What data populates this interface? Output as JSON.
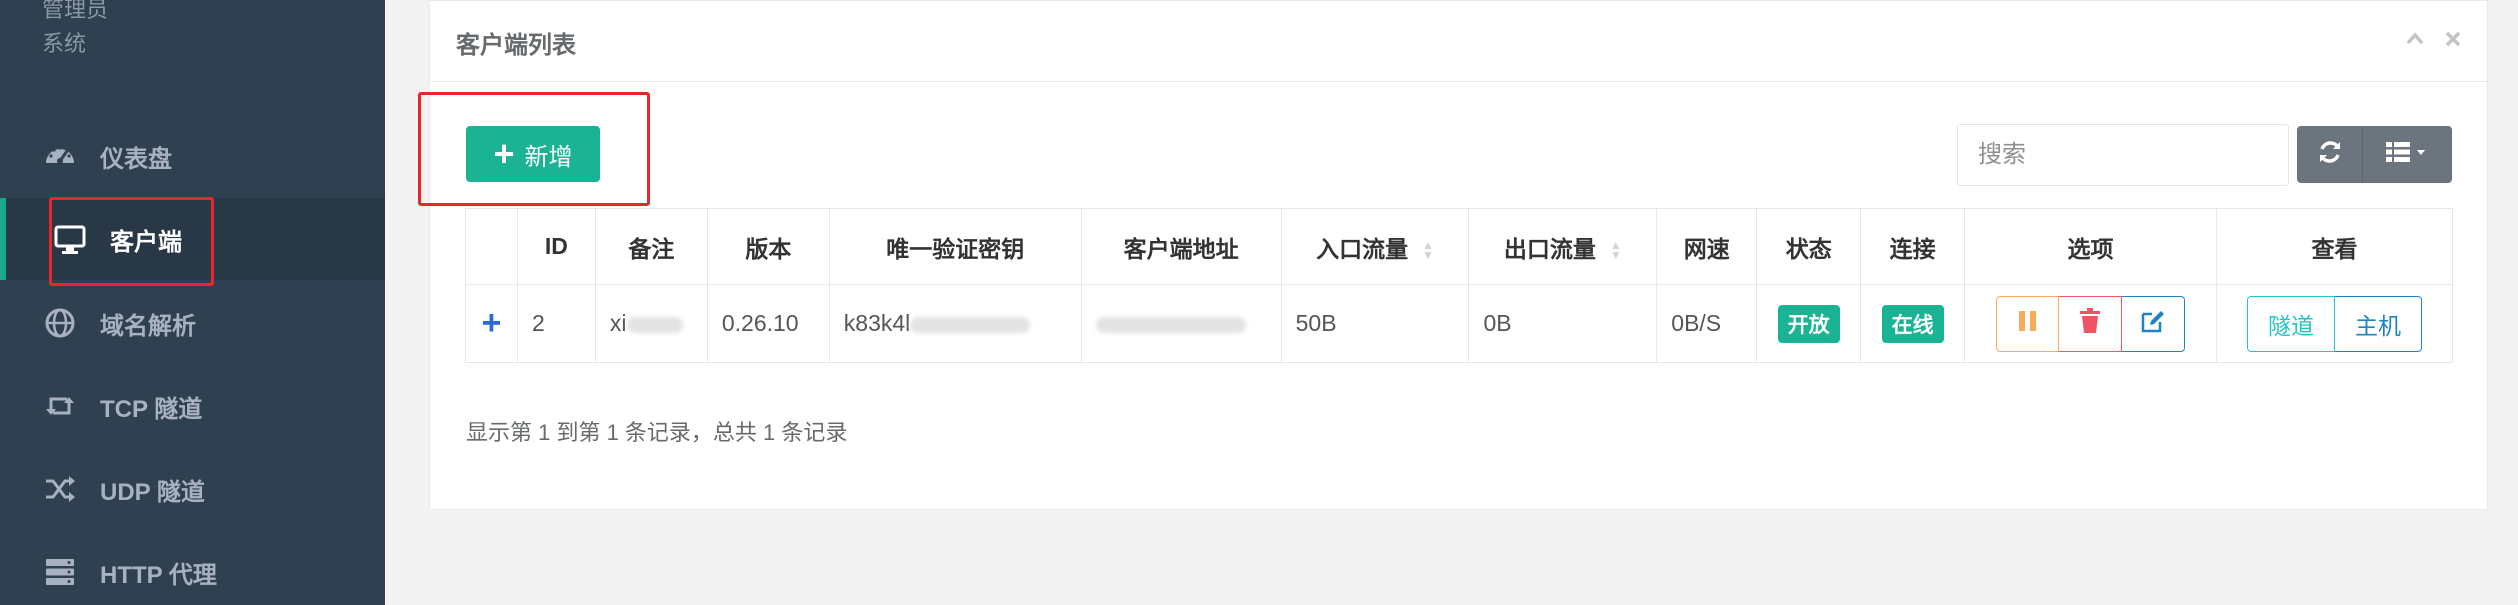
{
  "sidebar": {
    "role_top": "管理员",
    "role_bottom": "系统",
    "items": [
      {
        "label": "仪表盘",
        "icon": "dashboard-icon"
      },
      {
        "label": "客户端",
        "icon": "monitor-icon"
      },
      {
        "label": "域名解析",
        "icon": "globe-icon"
      },
      {
        "label": "TCP 隧道",
        "icon": "retweet-icon"
      },
      {
        "label": "UDP 隧道",
        "icon": "random-icon"
      },
      {
        "label": "HTTP 代理",
        "icon": "server-icon"
      }
    ],
    "active_index": 1
  },
  "panel": {
    "title": "客户端列表",
    "collapse_icon": "chevron-up-icon",
    "close_icon": "close-icon"
  },
  "toolbar": {
    "add_label": "新增",
    "search_placeholder": "搜索",
    "refresh_icon": "refresh-icon",
    "columns_icon": "list-columns-icon"
  },
  "table": {
    "headers": [
      "",
      "ID",
      "备注",
      "版本",
      "唯一验证密钥",
      "客户端地址",
      "入口流量",
      "出口流量",
      "网速",
      "状态",
      "连接",
      "选项",
      "查看"
    ],
    "sortable_columns": [
      "入口流量",
      "出口流量"
    ],
    "rows": [
      {
        "expand": "+",
        "id": "2",
        "remark": "xi",
        "version": "0.26.10",
        "key": "k83k4l",
        "address": "",
        "inflow": "50B",
        "outflow": "0B",
        "speed": "0B/S",
        "status": "开放",
        "connection": "在线",
        "view_tunnel": "隧道",
        "view_host": "主机"
      }
    ]
  },
  "footer": {
    "info": "显示第 1 到第 1 条记录，总共 1 条记录"
  },
  "colors": {
    "sidebar_bg": "#2f4050",
    "accent": "#1ab394",
    "annotation": "#e8262b"
  }
}
